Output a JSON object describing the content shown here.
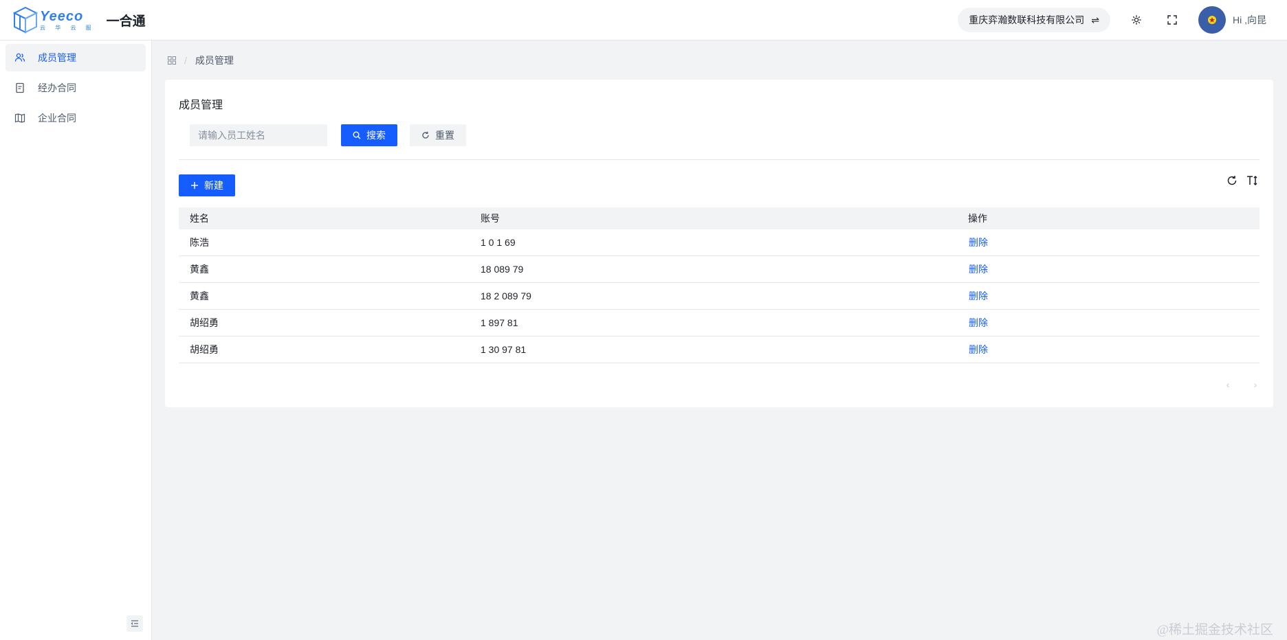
{
  "header": {
    "logo_word": "Yeeco",
    "logo_sub": "云 华 云 服",
    "app_title": "一合通",
    "company": "重庆弈瀚数联科技有限公司",
    "swap_glyph": "⇌",
    "greeting": "Hi ,向昆",
    "icons": [
      "theme-icon",
      "fullscreen-icon",
      "avatar"
    ]
  },
  "sidebar": {
    "items": [
      {
        "label": "成员管理",
        "icon": "users-icon",
        "active": true
      },
      {
        "label": "经办合同",
        "icon": "document-icon",
        "active": false
      },
      {
        "label": "企业合同",
        "icon": "book-icon",
        "active": false
      }
    ]
  },
  "breadcrumb": {
    "icon": "apps-icon",
    "separator": "/",
    "current": "成员管理"
  },
  "card": {
    "title": "成员管理",
    "search_placeholder": "请输入员工姓名",
    "search_value": "",
    "search_label": "搜索",
    "reset_label": "重置",
    "new_label": "新建"
  },
  "table": {
    "columns": [
      "姓名",
      "账号",
      "操作"
    ],
    "rows": [
      {
        "name": "陈浩",
        "account": "1 0 1 69",
        "action": "删除"
      },
      {
        "name": "黄鑫",
        "account": "18 089 79",
        "action": "删除"
      },
      {
        "name": "黄鑫",
        "account": "18 2 089 79",
        "action": "删除"
      },
      {
        "name": "胡绍勇",
        "account": "1 897 81",
        "action": "删除"
      },
      {
        "name": "胡绍勇",
        "account": "1 30 97 81",
        "action": "删除"
      }
    ]
  },
  "pager": {
    "prev": "‹",
    "next": "›"
  },
  "watermark": "@稀土掘金技术社区",
  "colors": {
    "primary": "#165dff",
    "bg": "#f2f3f5",
    "avatar": "#3b5ea8"
  }
}
